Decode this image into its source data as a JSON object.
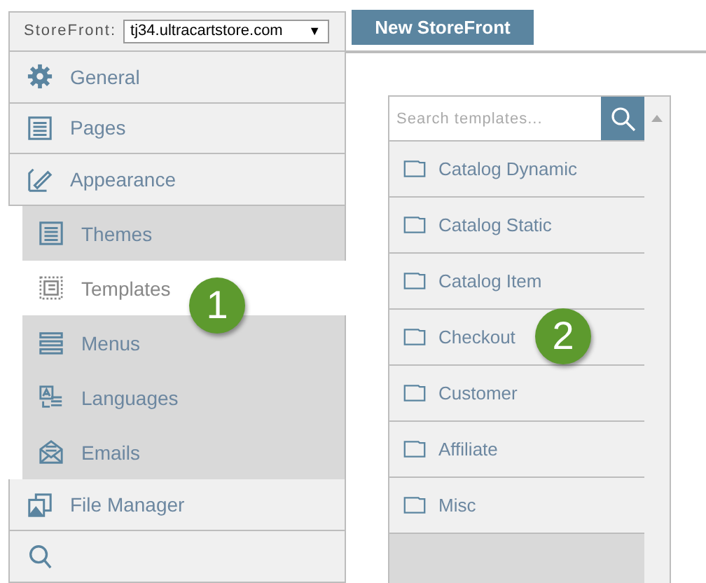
{
  "storefront": {
    "label": "StoreFront:",
    "value": "tj34.ultracartstore.com",
    "caret": "▼"
  },
  "new_button": "New StoreFront",
  "nav": [
    {
      "label": "General",
      "kind": "gear",
      "selected": false
    },
    {
      "label": "Pages",
      "kind": "page",
      "selected": false
    },
    {
      "label": "Appearance",
      "kind": "pencil",
      "selected": false,
      "children": [
        {
          "label": "Themes",
          "kind": "page",
          "selected": false
        },
        {
          "label": "Templates",
          "kind": "template",
          "selected": true
        },
        {
          "label": "Menus",
          "kind": "menu",
          "selected": false
        },
        {
          "label": "Languages",
          "kind": "lang",
          "selected": false
        },
        {
          "label": "Emails",
          "kind": "mail",
          "selected": false
        }
      ]
    },
    {
      "label": "File Manager",
      "kind": "files",
      "selected": false
    },
    {
      "kind": "search",
      "selected": false
    }
  ],
  "templates": {
    "placeholder": "Search templates...",
    "items": [
      {
        "label": "Catalog Dynamic"
      },
      {
        "label": "Catalog Static"
      },
      {
        "label": "Catalog Item"
      },
      {
        "label": "Checkout"
      },
      {
        "label": "Customer"
      },
      {
        "label": "Affiliate"
      },
      {
        "label": "Misc"
      }
    ]
  },
  "callouts": [
    {
      "number": "1",
      "kind": "nav"
    },
    {
      "number": "2",
      "kind": "template"
    }
  ]
}
